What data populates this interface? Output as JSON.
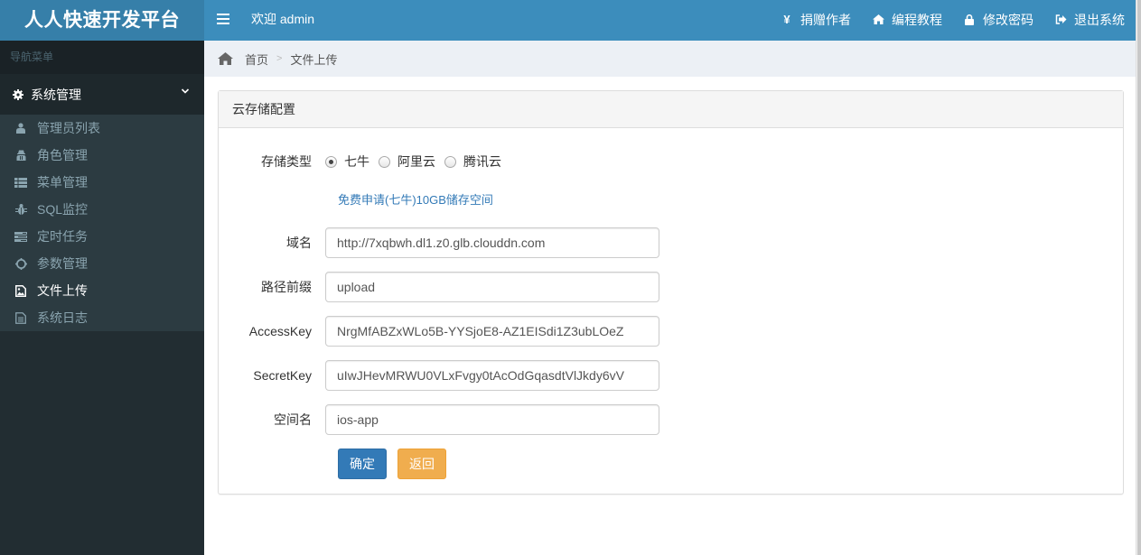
{
  "header": {
    "logo": "人人快速开发平台",
    "welcome": "欢迎 admin",
    "nav": [
      {
        "icon": "yen-icon",
        "label": "捐赠作者"
      },
      {
        "icon": "home-icon",
        "label": "编程教程"
      },
      {
        "icon": "lock-icon",
        "label": "修改密码"
      },
      {
        "icon": "sign-out-icon",
        "label": "退出系统"
      }
    ]
  },
  "sidebar": {
    "header": "导航菜单",
    "group": {
      "icon": "gear-icon",
      "label": "系统管理",
      "expanded": true
    },
    "items": [
      {
        "icon": "user-icon",
        "label": "管理员列表",
        "active": false
      },
      {
        "icon": "user-secret-icon",
        "label": "角色管理",
        "active": false
      },
      {
        "icon": "list-icon",
        "label": "菜单管理",
        "active": false
      },
      {
        "icon": "bug-icon",
        "label": "SQL监控",
        "active": false
      },
      {
        "icon": "tasks-icon",
        "label": "定时任务",
        "active": false
      },
      {
        "icon": "cog-icon",
        "label": "参数管理",
        "active": false
      },
      {
        "icon": "file-image-icon",
        "label": "文件上传",
        "active": true
      },
      {
        "icon": "file-text-icon",
        "label": "系统日志",
        "active": false
      }
    ]
  },
  "breadcrumb": {
    "home": "首页",
    "separator": ">",
    "current": "文件上传"
  },
  "panel": {
    "title": "云存储配置",
    "storage_type": {
      "label": "存储类型",
      "options": [
        "七牛",
        "阿里云",
        "腾讯云"
      ],
      "selected": "七牛"
    },
    "free_link": "免费申请(七牛)10GB储存空间",
    "fields": [
      {
        "label": "域名",
        "value": "http://7xqbwh.dl1.z0.glb.clouddn.com"
      },
      {
        "label": "路径前缀",
        "value": "upload"
      },
      {
        "label": "AccessKey",
        "value": "NrgMfABZxWLo5B-YYSjoE8-AZ1EISdi1Z3ubLOeZ"
      },
      {
        "label": "SecretKey",
        "value": "uIwJHevMRWU0VLxFvgy0tAcOdGqasdtVlJkdy6vV"
      },
      {
        "label": "空间名",
        "value": "ios-app"
      }
    ],
    "buttons": {
      "confirm": "确定",
      "back": "返回"
    }
  },
  "colors": {
    "header": "#3c8dbc",
    "logo": "#367fa9",
    "sidebar": "#222d32",
    "primary": "#337ab7",
    "warning": "#f0ad4e"
  }
}
